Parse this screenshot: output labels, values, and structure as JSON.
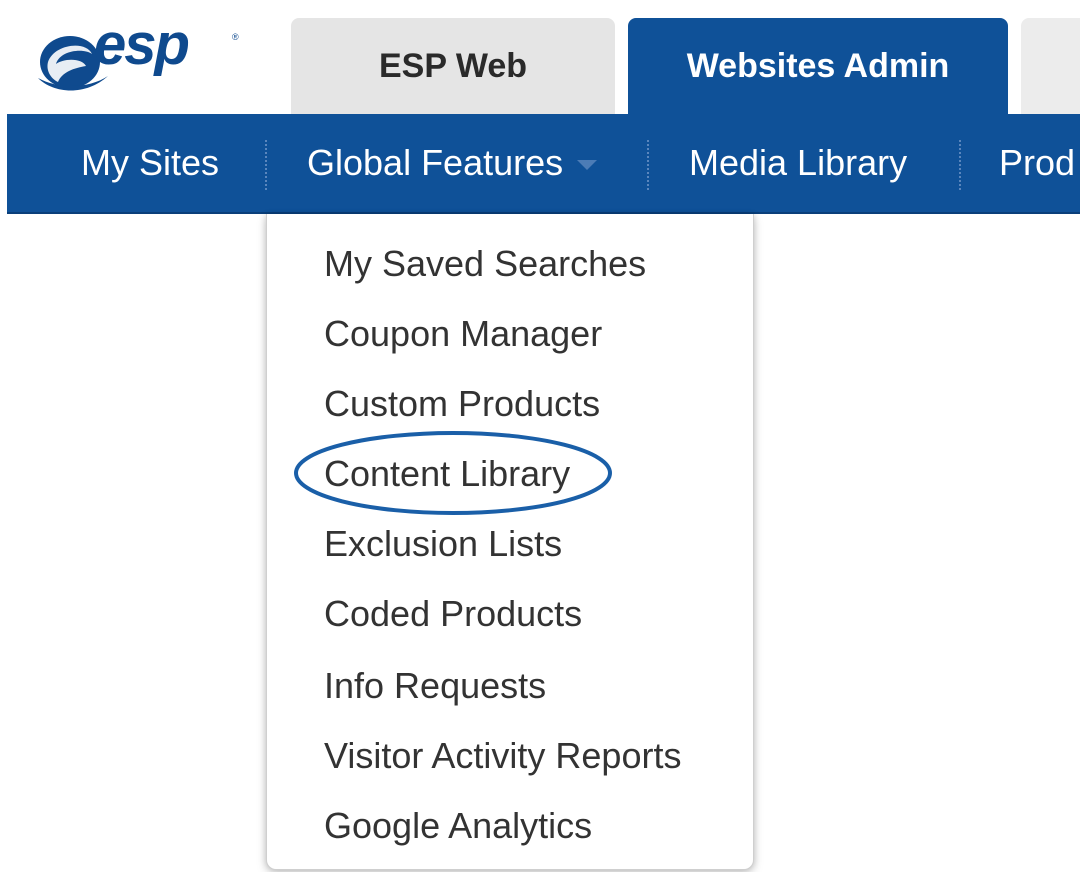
{
  "logo": {
    "text": "esp",
    "registered_mark": "®",
    "icon": "esp-swoosh-icon",
    "brand_color": "#0f4a8e"
  },
  "tabs": [
    {
      "label": "ESP Web",
      "active": false
    },
    {
      "label": "Websites Admin",
      "active": true
    }
  ],
  "nav": {
    "items": [
      {
        "label": "My Sites"
      },
      {
        "label": "Global Features",
        "has_dropdown": true,
        "icon": "caret-down-icon"
      },
      {
        "label": "Media Library"
      },
      {
        "label": "Prod"
      }
    ],
    "background_color": "#0f5198"
  },
  "dropdown": {
    "items": [
      {
        "label": "My Saved Searches"
      },
      {
        "label": "Coupon Manager"
      },
      {
        "label": "Custom Products"
      },
      {
        "label": "Content Library",
        "highlighted": true
      },
      {
        "label": "Exclusion Lists"
      },
      {
        "label": "Coded Products"
      },
      {
        "label": "Info Requests"
      },
      {
        "label": "Visitor Activity Reports"
      },
      {
        "label": "Google Analytics"
      }
    ],
    "highlight_color": "#1a5fa8"
  }
}
